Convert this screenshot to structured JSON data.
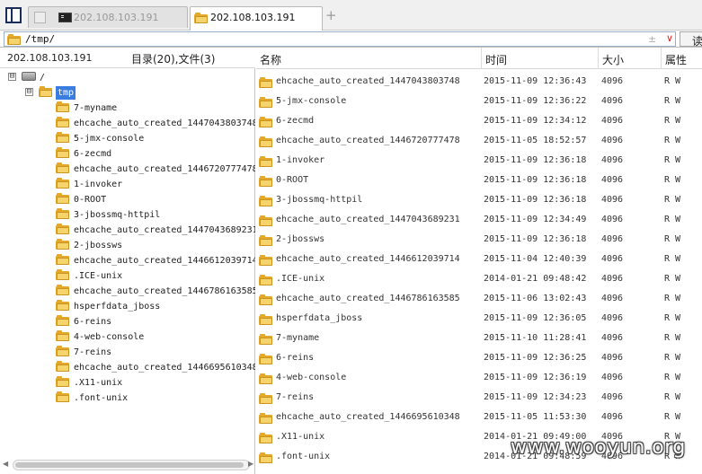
{
  "tabs": [
    {
      "label": "202.108.103.191",
      "icon": "terminal-icon",
      "active": false
    },
    {
      "label": "202.108.103.191",
      "icon": "folder-icon",
      "active": true
    }
  ],
  "new_tab_label": "+",
  "address": {
    "value": "/tmp/",
    "star": "±",
    "dropdown": "∨",
    "read_button": "读"
  },
  "left_panel": {
    "host": "202.108.103.191",
    "summary": "目录(20),文件(3)",
    "root": {
      "expander": "⊟",
      "label": "/"
    },
    "tmp": {
      "expander": "⊟",
      "label": "tmp"
    },
    "children": [
      "7-myname",
      "ehcache_auto_created_1447043803748",
      "5-jmx-console",
      "6-zecmd",
      "ehcache_auto_created_1446720777478",
      "1-invoker",
      "0-ROOT",
      "3-jbossmq-httpil",
      "ehcache_auto_created_1447043689231",
      "2-jbossws",
      "ehcache_auto_created_1446612039714",
      ".ICE-unix",
      "ehcache_auto_created_1446786163585",
      "hsperfdata_jboss",
      "6-reins",
      "4-web-console",
      "7-reins",
      "ehcache_auto_created_1446695610348",
      ".X11-unix",
      ".font-unix"
    ]
  },
  "columns": {
    "name": "名称",
    "time": "时间",
    "size": "大小",
    "attr": "属性"
  },
  "files": [
    {
      "name": "ehcache_auto_created_1447043803748",
      "time": "2015-11-09 12:36:43",
      "size": "4096",
      "attr": "R W"
    },
    {
      "name": "5-jmx-console",
      "time": "2015-11-09 12:36:22",
      "size": "4096",
      "attr": "R W"
    },
    {
      "name": "6-zecmd",
      "time": "2015-11-09 12:34:12",
      "size": "4096",
      "attr": "R W"
    },
    {
      "name": "ehcache_auto_created_1446720777478",
      "time": "2015-11-05 18:52:57",
      "size": "4096",
      "attr": "R W"
    },
    {
      "name": "1-invoker",
      "time": "2015-11-09 12:36:18",
      "size": "4096",
      "attr": "R W"
    },
    {
      "name": "0-ROOT",
      "time": "2015-11-09 12:36:18",
      "size": "4096",
      "attr": "R W"
    },
    {
      "name": "3-jbossmq-httpil",
      "time": "2015-11-09 12:36:18",
      "size": "4096",
      "attr": "R W"
    },
    {
      "name": "ehcache_auto_created_1447043689231",
      "time": "2015-11-09 12:34:49",
      "size": "4096",
      "attr": "R W"
    },
    {
      "name": "2-jbossws",
      "time": "2015-11-09 12:36:18",
      "size": "4096",
      "attr": "R W"
    },
    {
      "name": "ehcache_auto_created_1446612039714",
      "time": "2015-11-04 12:40:39",
      "size": "4096",
      "attr": "R W"
    },
    {
      "name": ".ICE-unix",
      "time": "2014-01-21 09:48:42",
      "size": "4096",
      "attr": "R W"
    },
    {
      "name": "ehcache_auto_created_1446786163585",
      "time": "2015-11-06 13:02:43",
      "size": "4096",
      "attr": "R W"
    },
    {
      "name": "hsperfdata_jboss",
      "time": "2015-11-09 12:36:05",
      "size": "4096",
      "attr": "R W"
    },
    {
      "name": "7-myname",
      "time": "2015-11-10 11:28:41",
      "size": "4096",
      "attr": "R W"
    },
    {
      "name": "6-reins",
      "time": "2015-11-09 12:36:25",
      "size": "4096",
      "attr": "R W"
    },
    {
      "name": "4-web-console",
      "time": "2015-11-09 12:36:19",
      "size": "4096",
      "attr": "R W"
    },
    {
      "name": "7-reins",
      "time": "2015-11-09 12:34:23",
      "size": "4096",
      "attr": "R W"
    },
    {
      "name": "ehcache_auto_created_1446695610348",
      "time": "2015-11-05 11:53:30",
      "size": "4096",
      "attr": "R W"
    },
    {
      "name": ".X11-unix",
      "time": "2014-01-21 09:49:00",
      "size": "4096",
      "attr": "R W"
    },
    {
      "name": ".font-unix",
      "time": "2014-01-21 09:48:59",
      "size": "4096",
      "attr": "R W"
    }
  ],
  "watermark": "www.wooyun.org",
  "colors": {
    "accent": "#3a7de0",
    "folder": "#f7d46b",
    "sidebar_button": "#1a2d5a"
  }
}
